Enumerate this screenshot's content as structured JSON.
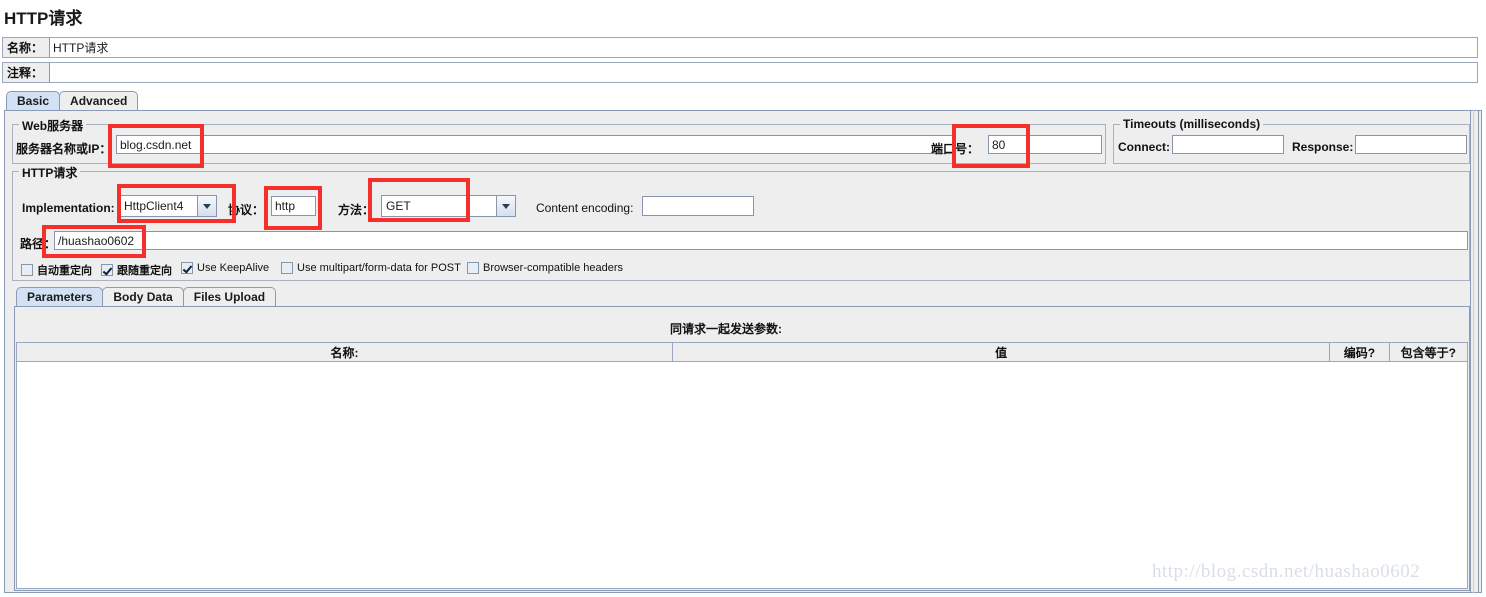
{
  "window": {
    "title": "HTTP请求"
  },
  "fields": {
    "name_label": "名称：",
    "name_value": "HTTP请求",
    "comment_label": "注释：",
    "comment_value": ""
  },
  "main_tabs": [
    {
      "label": "Basic",
      "selected": true
    },
    {
      "label": "Advanced",
      "selected": false
    }
  ],
  "web_server": {
    "group_title": "Web服务器",
    "server_label": "服务器名称或IP：",
    "server_value": "blog.csdn.net",
    "port_label": "端口号：",
    "port_value": "80"
  },
  "timeouts": {
    "group_title": "Timeouts (milliseconds)",
    "connect_label": "Connect:",
    "connect_value": "",
    "response_label": "Response:",
    "response_value": ""
  },
  "http_request": {
    "group_title": "HTTP请求",
    "implementation_label": "Implementation:",
    "implementation_value": "HttpClient4",
    "protocol_label": "协议：",
    "protocol_value": "http",
    "method_label": "方法：",
    "method_value": "GET",
    "content_encoding_label": "Content encoding:",
    "content_encoding_value": "",
    "path_label": "路径：",
    "path_value": "/huashao0602"
  },
  "checkboxes": [
    {
      "label": "自动重定向",
      "checked": false,
      "cn": true
    },
    {
      "label": "跟随重定向",
      "checked": true,
      "cn": true
    },
    {
      "label": "Use KeepAlive",
      "checked": true,
      "cn": false
    },
    {
      "label": "Use multipart/form-data for POST",
      "checked": false,
      "cn": false
    },
    {
      "label": "Browser-compatible headers",
      "checked": false,
      "cn": false
    }
  ],
  "param_tabs": [
    {
      "label": "Parameters",
      "selected": true
    },
    {
      "label": "Body Data",
      "selected": false
    },
    {
      "label": "Files Upload",
      "selected": false
    }
  ],
  "params_table": {
    "caption": "同请求一起发送参数:",
    "columns": [
      "名称:",
      "值",
      "编码?",
      "包含等于?"
    ],
    "rows": []
  },
  "watermark": {
    "text": "http://blog.csdn.net/huashao0602"
  },
  "colors": {
    "annotation": "#f5302c",
    "panel_bg": "#eeeeee",
    "tab_selected": "#d2e1f3",
    "border": "#8c9bb5"
  }
}
